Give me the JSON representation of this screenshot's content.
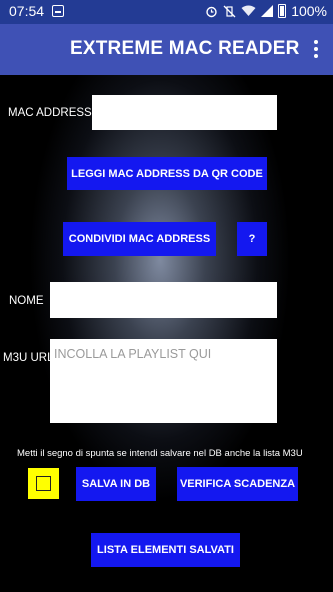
{
  "status_bar": {
    "time": "07:54",
    "battery": "100%",
    "icons": [
      "notification-icon",
      "alarm-icon",
      "vibrate-off-icon",
      "wifi-icon",
      "signal-icon",
      "battery-icon"
    ]
  },
  "app_bar": {
    "title": "EXTREME MAC READER",
    "menu_icon": "overflow-menu-icon"
  },
  "form": {
    "mac_label": "MAC ADDRESS",
    "mac_value": "",
    "read_qr_button": "LEGGI MAC ADDRESS DA QR CODE",
    "share_mac_button": "CONDIVIDI MAC ADDRESS",
    "help_button": "?",
    "name_label": "NOME",
    "name_value": "",
    "m3u_label": "M3U URL",
    "m3u_placeholder": "INCOLLA LA PLAYLIST QUI",
    "checkbox_hint": "Metti il segno di spunta se intendi salvare nel DB anche la lista M3U",
    "checkbox_checked": false,
    "save_button": "SALVA IN DB",
    "check_expiry_button": "VERIFICA SCADENZA",
    "saved_list_button": "LISTA ELEMENTI SALVATI"
  },
  "colors": {
    "app_bar": "#3f51b5",
    "status_bar": "#233b94",
    "button": "#1418f0",
    "checkbox_bg": "#ffff00"
  }
}
